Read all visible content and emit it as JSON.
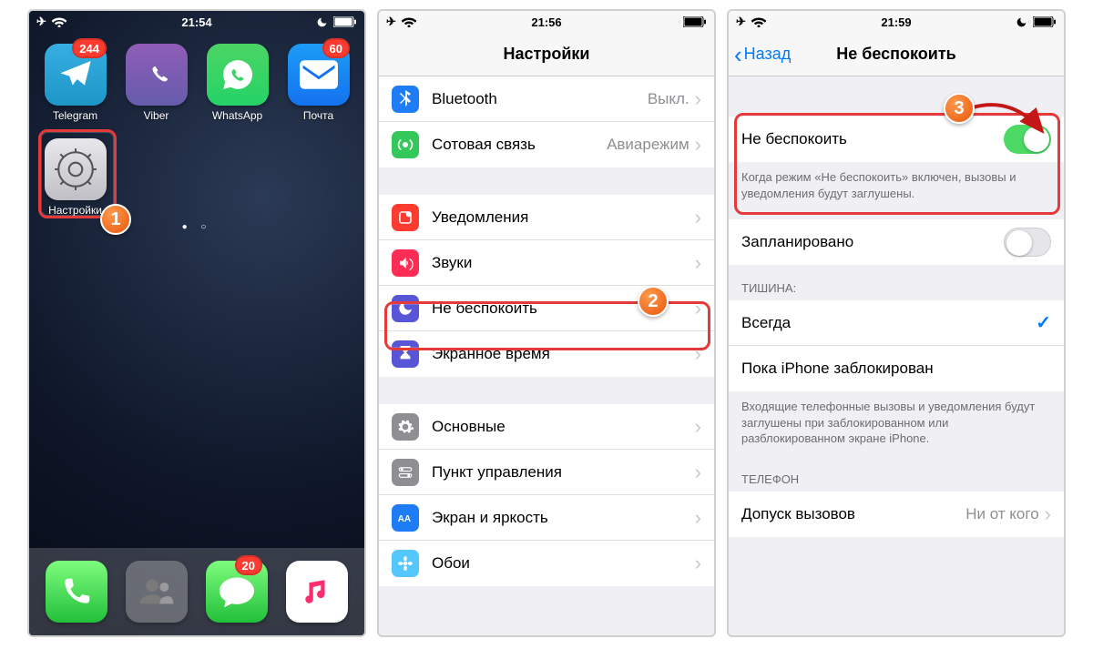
{
  "screen1": {
    "status": {
      "time": "21:54"
    },
    "apps": [
      {
        "id": "telegram",
        "label": "Telegram",
        "badge": "244"
      },
      {
        "id": "viber",
        "label": "Viber"
      },
      {
        "id": "whatsapp",
        "label": "WhatsApp"
      },
      {
        "id": "mail",
        "label": "Почта",
        "badge": "60"
      },
      {
        "id": "settings",
        "label": "Настройки"
      }
    ],
    "dock": [
      {
        "id": "phone"
      },
      {
        "id": "contacts"
      },
      {
        "id": "messages",
        "badge": "20"
      },
      {
        "id": "music"
      }
    ]
  },
  "screen2": {
    "status": {
      "time": "21:56"
    },
    "title": "Настройки",
    "group1": [
      {
        "id": "bluetooth",
        "label": "Bluetooth",
        "detail": "Выкл.",
        "iconColor": "#1e7cf6",
        "glyph": "bt"
      },
      {
        "id": "cellular",
        "label": "Сотовая связь",
        "detail": "Авиарежим",
        "iconColor": "#34c759",
        "glyph": "antenna"
      }
    ],
    "group2": [
      {
        "id": "notifications",
        "label": "Уведомления",
        "iconColor": "#fe3b30",
        "glyph": "notif"
      },
      {
        "id": "sounds",
        "label": "Звуки",
        "iconColor": "#fe2d55",
        "glyph": "sound"
      },
      {
        "id": "dnd",
        "label": "Не беспокоить",
        "iconColor": "#5856d6",
        "glyph": "moon"
      },
      {
        "id": "screentime",
        "label": "Экранное время",
        "iconColor": "#5856d6",
        "glyph": "hourglass"
      }
    ],
    "group3": [
      {
        "id": "general",
        "label": "Основные",
        "iconColor": "#8e8e93",
        "glyph": "gear"
      },
      {
        "id": "controlcenter",
        "label": "Пункт управления",
        "iconColor": "#8e8e93",
        "glyph": "switches"
      },
      {
        "id": "display",
        "label": "Экран и яркость",
        "iconColor": "#1e7cf6",
        "glyph": "brightness"
      },
      {
        "id": "wallpaper",
        "label": "Обои",
        "iconColor": "#54c7fc",
        "glyph": "flower"
      }
    ]
  },
  "screen3": {
    "status": {
      "time": "21:59"
    },
    "back": "Назад",
    "title": "Не беспокоить",
    "dnd_row": {
      "label": "Не беспокоить",
      "on": true
    },
    "dnd_footer": "Когда режим «Не беспокоить» включен, вызовы и уведомления будут заглушены.",
    "scheduled": {
      "label": "Запланировано",
      "on": false
    },
    "silence_header": "ТИШИНА:",
    "silence_options": [
      {
        "label": "Всегда",
        "selected": true
      },
      {
        "label": "Пока iPhone заблокирован",
        "selected": false
      }
    ],
    "silence_footer": "Входящие телефонные вызовы и уведомления будут заглушены при заблокированном или разблокированном экране iPhone.",
    "phone_header": "ТЕЛЕФОН",
    "allow_calls": {
      "label": "Допуск вызовов",
      "detail": "Ни от кого"
    }
  },
  "callouts": {
    "one": "1",
    "two": "2",
    "three": "3"
  }
}
